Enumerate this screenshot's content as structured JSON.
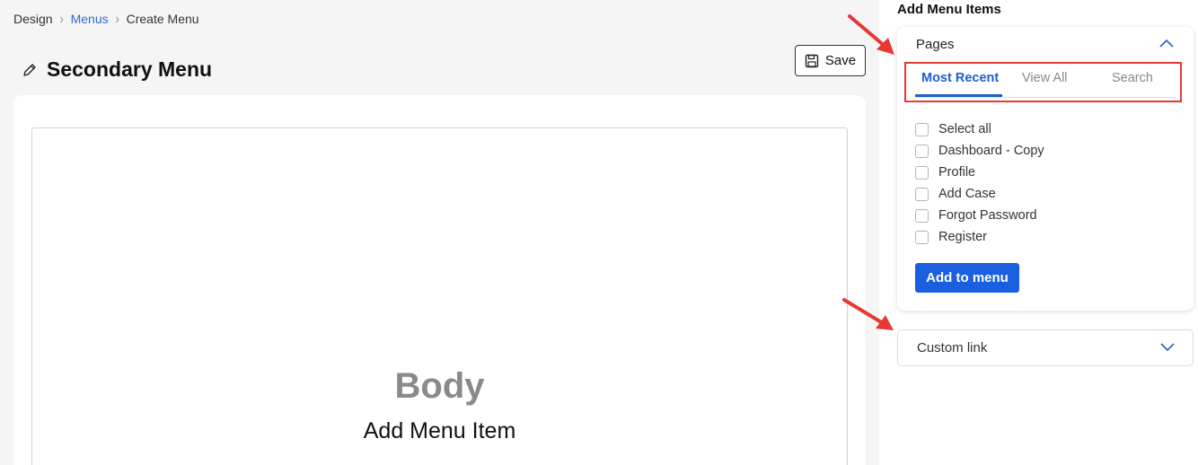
{
  "breadcrumb": {
    "items": [
      "Design",
      "Menus",
      "Create Menu"
    ]
  },
  "header": {
    "title": "Secondary Menu",
    "save_label": "Save"
  },
  "canvas": {
    "body_label": "Body",
    "add_item_label": "Add Menu Item"
  },
  "panel": {
    "heading": "Add Menu Items",
    "pages": {
      "title": "Pages",
      "tabs": [
        {
          "label": "Most Recent",
          "active": true
        },
        {
          "label": "View All",
          "active": false
        },
        {
          "label": "Search",
          "active": false
        }
      ],
      "items": [
        "Select all",
        "Dashboard - Copy",
        "Profile",
        "Add Case",
        "Forgot Password",
        "Register"
      ],
      "add_button": "Add to menu"
    },
    "custom_link": {
      "title": "Custom link"
    }
  },
  "colors": {
    "accent": "#1a5fe0",
    "link": "#2e6bd1",
    "annotation": "#e53935"
  }
}
